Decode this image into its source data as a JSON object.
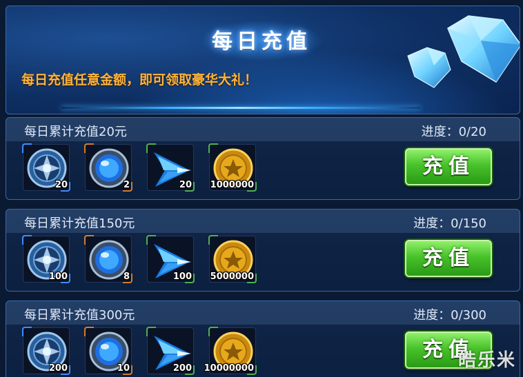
{
  "banner": {
    "title": "每日充值",
    "subtitle": "每日充值任意金额，即可领取豪华大礼！"
  },
  "tiers": [
    {
      "label": "每日累计充值20元",
      "progress": "进度：0/20",
      "button": "充值",
      "rewards": [
        {
          "icon": "shield-disc-icon",
          "qty": "20"
        },
        {
          "icon": "blue-orb-icon",
          "qty": "2"
        },
        {
          "icon": "blue-wing-icon",
          "qty": "20"
        },
        {
          "icon": "gold-coin-icon",
          "qty": "1000000"
        }
      ]
    },
    {
      "label": "每日累计充值150元",
      "progress": "进度：0/150",
      "button": "充值",
      "rewards": [
        {
          "icon": "shield-disc-icon",
          "qty": "100"
        },
        {
          "icon": "blue-orb-icon",
          "qty": "8"
        },
        {
          "icon": "blue-wing-icon",
          "qty": "100"
        },
        {
          "icon": "gold-coin-icon",
          "qty": "5000000"
        }
      ]
    },
    {
      "label": "每日累计充值300元",
      "progress": "进度：0/300",
      "button": "充值",
      "rewards": [
        {
          "icon": "shield-disc-icon",
          "qty": "200"
        },
        {
          "icon": "blue-orb-icon",
          "qty": "10"
        },
        {
          "icon": "blue-wing-icon",
          "qty": "200"
        },
        {
          "icon": "gold-coin-icon",
          "qty": "10000000"
        }
      ]
    }
  ],
  "watermark": "皓乐米",
  "colors": {
    "subtitle": "#ffb43a",
    "button_green": "#48c22a",
    "panel_blue": "#0e2f63"
  }
}
